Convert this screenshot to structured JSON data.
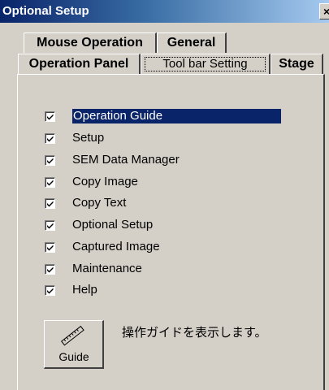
{
  "window": {
    "title": "Optional Setup",
    "close_label": "×"
  },
  "tabs": {
    "mouse_operation": "Mouse Operation",
    "general": "General",
    "operation_panel": "Operation Panel",
    "tool_bar_setting": "Tool bar Setting",
    "stage": "Stage",
    "active": "Tool bar Setting"
  },
  "toolbar_items": [
    {
      "label": "Operation Guide",
      "checked": true,
      "selected": true
    },
    {
      "label": "Setup",
      "checked": true,
      "selected": false
    },
    {
      "label": "SEM Data Manager",
      "checked": true,
      "selected": false
    },
    {
      "label": "Copy Image",
      "checked": true,
      "selected": false
    },
    {
      "label": "Copy Text",
      "checked": true,
      "selected": false
    },
    {
      "label": "Optional Setup",
      "checked": true,
      "selected": false
    },
    {
      "label": "Captured Image",
      "checked": true,
      "selected": false
    },
    {
      "label": "Maintenance",
      "checked": true,
      "selected": false
    },
    {
      "label": "Help",
      "checked": true,
      "selected": false
    }
  ],
  "preview": {
    "button_label": "Guide",
    "button_icon": "ruler-icon",
    "description": "操作ガイドを表示します。"
  },
  "colors": {
    "selection": "#0a246a",
    "titlebar_start": "#0a246a",
    "titlebar_end": "#a6caf0",
    "face": "#d4d0c8"
  }
}
